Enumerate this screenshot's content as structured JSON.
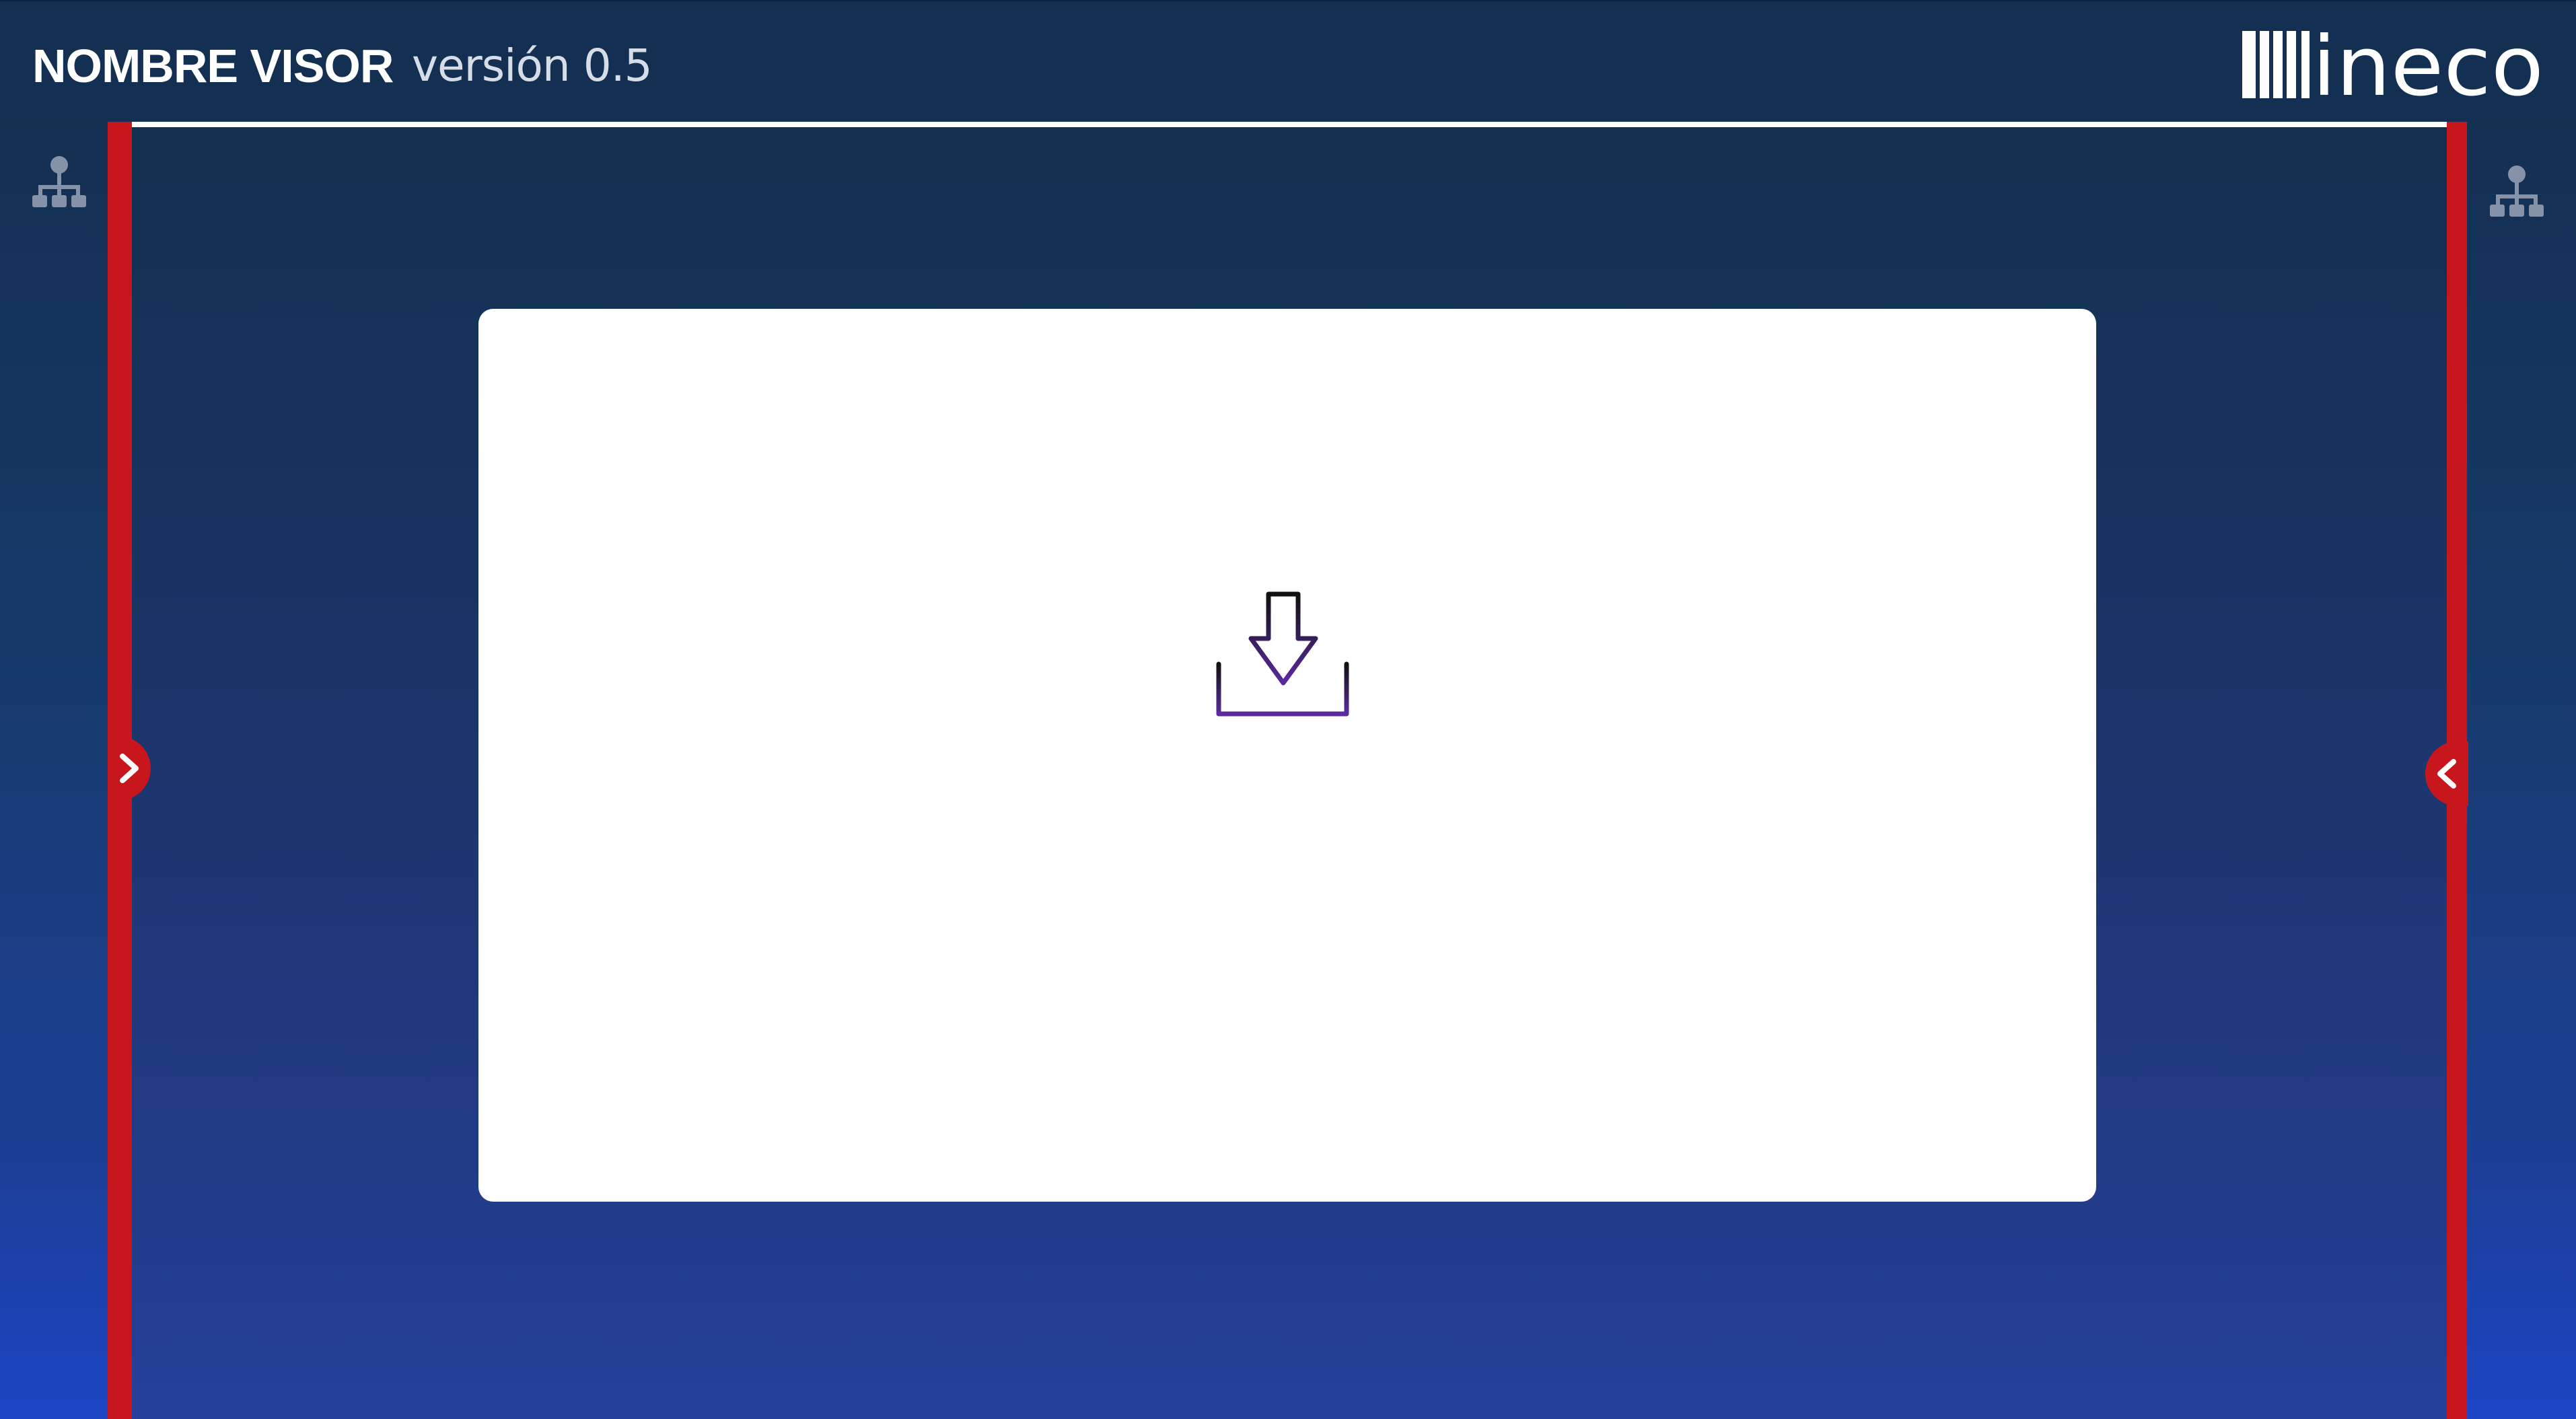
{
  "header": {
    "title": "NOMBRE VISOR",
    "version": "versión 0.5",
    "logo_text": "ineco"
  },
  "icons": {
    "left_panel": "hierarchy-icon",
    "right_panel": "hierarchy-icon",
    "left_toggle": "chevron-right-icon",
    "right_toggle": "chevron-left-icon",
    "upload": "download-tray-icon"
  },
  "colors": {
    "header_bg": "#132f51",
    "accent_red": "#c8161d",
    "panel_gradient_top": "#143052",
    "panel_gradient_bottom": "#1d44c4",
    "upload_icon_top": "#111111",
    "upload_icon_bottom": "#5a2a9f",
    "dropzone_bg": "#ffffff"
  }
}
